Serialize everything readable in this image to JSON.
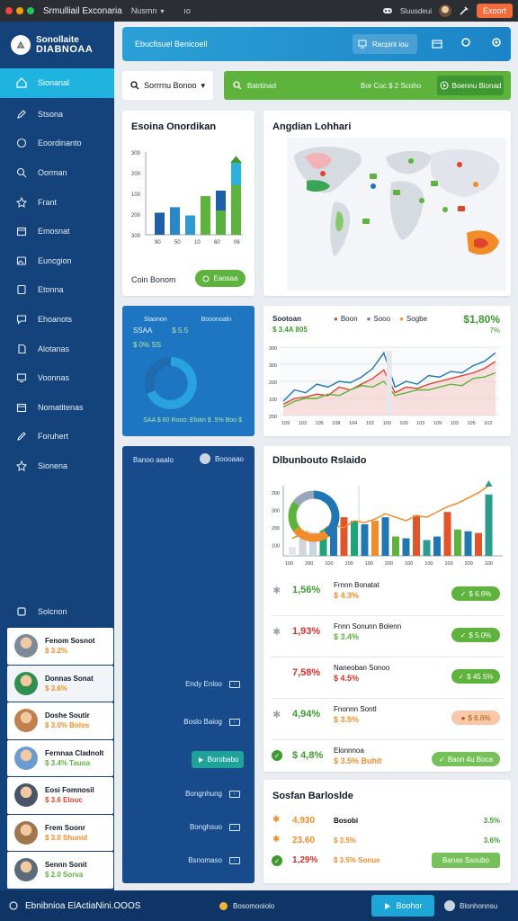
{
  "topbar": {
    "app_title": "Srmulliail Exconaria",
    "menu": "Nusmn",
    "more": "ıo",
    "user": "Sluusdeui",
    "export_label": "Exoort"
  },
  "sidebar": {
    "brand_line1": "Sonollaite",
    "brand_line2": "DIABNOAA",
    "items": [
      {
        "label": "Sionanal",
        "icon": "home-icon",
        "active": true
      },
      {
        "label": "Stsona",
        "icon": "edit-icon"
      },
      {
        "label": "Eoordinanto",
        "icon": "chat-icon"
      },
      {
        "label": "Oorman",
        "icon": "search-icon"
      },
      {
        "label": "Frant",
        "icon": "star-icon"
      },
      {
        "label": "Emosnat",
        "icon": "calendar-icon"
      },
      {
        "label": "Euncgion",
        "icon": "image-icon"
      },
      {
        "label": "Etonna",
        "icon": "document-icon"
      },
      {
        "label": "Ehoanots",
        "icon": "message-icon"
      },
      {
        "label": "Alotanas",
        "icon": "file-icon"
      },
      {
        "label": "Voonnas",
        "icon": "monitor-icon"
      },
      {
        "label": "Nomatitenas",
        "icon": "calendar-icon"
      },
      {
        "label": "Foruhert",
        "icon": "pencil-icon"
      },
      {
        "label": "Sionena",
        "icon": "star-icon"
      }
    ],
    "settings_label": "Solcnon",
    "users": [
      {
        "name": "Fenom Sosnot",
        "value": "$ 3.2%",
        "color": "#f28c28"
      },
      {
        "name": "Donnas Sonat",
        "value": "$ 3.6%",
        "color": "#f28c28"
      },
      {
        "name": "Doshe Soutir",
        "value": "$ 3.0% Bolos",
        "color": "#f28c28"
      },
      {
        "name": "Fernnaa Cladnolt",
        "value": "$ 3.4% Tauoa",
        "color": "#5db33c"
      },
      {
        "name": "Eosi Fomnosil",
        "value": "$ 3.6 Elouc",
        "color": "#e0442e"
      },
      {
        "name": "Frem Soonr",
        "value": "$ 3.0 Shunid",
        "color": "#f28c28"
      },
      {
        "name": "Sennn Sonit",
        "value": "$ 2.0 Sorva",
        "color": "#5db33c"
      }
    ]
  },
  "header": {
    "title": "Ebucfisuel Benicoell",
    "box_label": "Racpint iou",
    "filter_label": "Sorrrnu Bonoo",
    "green_left": "Batrtinad",
    "green_mid": "Bor Coc $ 2 Scoho",
    "green_button": "Boennu Bionad"
  },
  "cards": {
    "onordikan": {
      "title": "Esoina Onordikan",
      "footer_label": "Coin Bonom",
      "button_label": "Eaosaa"
    },
    "map": {
      "title": "Angdian Lohhari"
    },
    "blue": {
      "row1": [
        "Slaonon",
        "Booonoaln"
      ],
      "row2": [
        "SSAA",
        "$ 5.5"
      ],
      "row3": "$ 0% SS",
      "footer": "SAA $ 60 Rooo: Eloan $ .5% Boo $"
    },
    "line": {
      "legend_label": "Sootoan",
      "legend_value": "$ 3.4A 805",
      "items": [
        "Boon",
        "Sooo",
        "Sogbe"
      ],
      "big_value": "$1,80%",
      "big_sub": "7%"
    },
    "navy": {
      "header_left": "Banoo aaalo",
      "header_right": "Boooaao",
      "row1": "Endy Enloo",
      "row2": "Boslo Baiog",
      "active_button": "Borobabo",
      "row4": "Bongnhung",
      "row5": "Bonghsuo",
      "row6": "Bsnomaso"
    },
    "dist": {
      "title": "Dlbunbouto Rslaido",
      "rows": [
        {
          "pct": "1,56%",
          "pct_color": "#3e9a2e",
          "name": "Frnnn Bonatat",
          "sub": "$ 4.3%",
          "sub_color": "#f28c28",
          "chip": "$ 6.6%",
          "chip_color": "#5db33c",
          "mark": "asterisk"
        },
        {
          "pct": "1,93%",
          "pct_color": "#d9302a",
          "name": "Fnnn Sonunn Bolenn",
          "sub": "$ 3.4%",
          "sub_color": "#5db33c",
          "chip": "$ 5.0%",
          "chip_color": "#5db33c",
          "mark": "asterisk"
        },
        {
          "pct": "7,58%",
          "pct_color": "#d9302a",
          "name": "Naneoban Sonoo",
          "sub": "$ 4.5%",
          "sub_color": "#d9302a",
          "chip": "$ 45 5%",
          "chip_color": "#5db33c",
          "mark": "none"
        },
        {
          "pct": "4,94%",
          "pct_color": "#3e9a2e",
          "name": "Fnonnn Sontl",
          "sub": "$ 3.5%",
          "sub_color": "#f28c28",
          "chip": "$ 6.6%",
          "chip_color": "#f7c9a8",
          "mark": "asterisk"
        },
        {
          "pct": "$ 4,8%",
          "pct_color": "#3e9a2e",
          "name": "Elonnnoa",
          "sub": "$ 3.5% Buhit",
          "sub_color": "#f28c28",
          "chip": "Baon 4u Boca",
          "chip_color": "#77c15a",
          "mark": "check"
        }
      ]
    },
    "sostan": {
      "title": "Sosfan Barloslde",
      "rows": [
        {
          "pct": "4,930",
          "pct_color": "#f28c28",
          "name": "Bosobi",
          "right": "3.5%",
          "right_color": "#3e9a2e",
          "mark": "asterisk-orange"
        },
        {
          "pct": "23.60",
          "pct_color": "#f28c28",
          "name": "$ 3.5%",
          "name_color": "#f28c28",
          "right": "3.6%",
          "right_color": "#3e9a2e",
          "mark": "asterisk-orange"
        },
        {
          "pct": "1,29%",
          "pct_color": "#d9302a",
          "name": "$ 3.5% Sonue",
          "name_color": "#f28c28",
          "right": "Banas Ssoubo",
          "right_color": "#fff",
          "mark": "check"
        }
      ]
    }
  },
  "bottombar": {
    "title": "Ebnibnioa ElActiaNini.OOOS",
    "status": "Bosomooiolo",
    "run_label": "Boohor",
    "user": "Blonhonnsu"
  },
  "colors": {
    "sidebar": "#13437a",
    "active": "#1fb3e0",
    "green": "#5db33c",
    "orange": "#f28c28",
    "red": "#d9302a",
    "blue": "#1e76c2"
  },
  "chart_data": [
    {
      "type": "bar",
      "categories": [
        "1",
        "2",
        "3",
        "4",
        "5",
        "6"
      ],
      "series": [
        {
          "values": [
            80,
            100,
            70,
            140,
            160,
            260
          ]
        }
      ],
      "ylim": [
        0,
        300
      ],
      "yticks": [
        "300",
        "200",
        "100",
        "200",
        "300"
      ],
      "xticks": [
        "90",
        "50",
        "10",
        "60",
        "06"
      ]
    },
    {
      "type": "line",
      "x": [
        1,
        2,
        3,
        4,
        5,
        6,
        7,
        8,
        9,
        10,
        11,
        12,
        13,
        14,
        15,
        16,
        17,
        18,
        19,
        20
      ],
      "series": [
        {
          "color": "#1f77b4",
          "values": [
            10,
            18,
            16,
            22,
            20,
            24,
            23,
            27,
            33,
            44,
            20,
            24,
            22,
            28,
            27,
            31,
            30,
            35,
            38,
            44
          ]
        },
        {
          "color": "#e0442e",
          "values": [
            8,
            12,
            13,
            15,
            14,
            20,
            18,
            22,
            26,
            32,
            16,
            20,
            19,
            22,
            24,
            26,
            28,
            30,
            33,
            38
          ]
        },
        {
          "color": "#5db33c",
          "values": [
            6,
            10,
            12,
            12,
            15,
            14,
            18,
            21,
            20,
            24,
            14,
            16,
            18,
            18,
            20,
            22,
            21,
            26,
            27,
            30
          ]
        }
      ],
      "yticks": [
        "300",
        "300",
        "200",
        "100",
        "200"
      ],
      "xticks": [
        "109",
        "103",
        "105",
        "108",
        "104",
        "102",
        "100",
        "109",
        "103",
        "109",
        "103",
        "105",
        "102"
      ]
    },
    {
      "type": "bar",
      "categories": [
        "1",
        "2",
        "3",
        "4",
        "5",
        "6",
        "7",
        "8",
        "9",
        "10",
        "11",
        "12",
        "13",
        "14",
        "15",
        "16",
        "17",
        "18",
        "19",
        "20"
      ],
      "series": [
        {
          "values": [
            10,
            20,
            30,
            34,
            38,
            44,
            40,
            36,
            40,
            44,
            22,
            20,
            46,
            18,
            22,
            50,
            30,
            28,
            26,
            70
          ]
        }
      ],
      "line": [
        20,
        25,
        30,
        32,
        35,
        32,
        40,
        38,
        42,
        48,
        44,
        40,
        46,
        44,
        50,
        56,
        60,
        66,
        72,
        80
      ],
      "donut": [
        {
          "value": 40,
          "color": "#1f77b4"
        },
        {
          "value": 25,
          "color": "#f28c28"
        },
        {
          "value": 20,
          "color": "#5db33c"
        },
        {
          "value": 15,
          "color": "#9aa6b8"
        }
      ],
      "yticks": [
        "200",
        "300",
        "200",
        "100"
      ],
      "xticks": [
        "100",
        "200",
        "100",
        "100",
        "100",
        "200",
        "100",
        "100",
        "100",
        "200",
        "100"
      ]
    }
  ]
}
